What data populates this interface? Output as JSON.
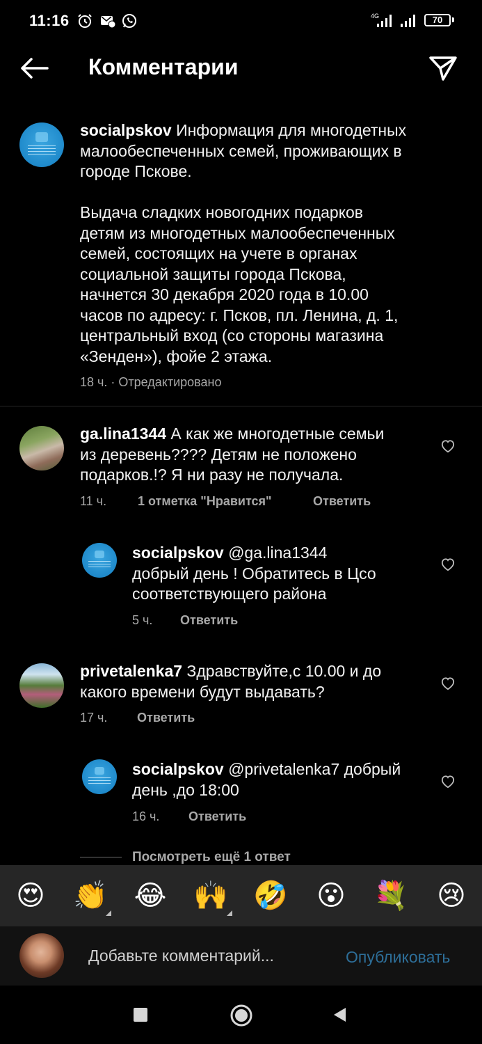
{
  "status_bar": {
    "time": "11:16",
    "network_label": "4G",
    "battery": "70"
  },
  "header": {
    "title": "Комментарии"
  },
  "post": {
    "username": "socialpskov",
    "caption_lines": [
      "Информация для многодетных",
      "малообеспеченных семей, проживающих в",
      "городе Пскове.",
      "",
      "Выдача сладких новогодних подарков",
      "детям из многодетных малообеспеченных",
      "семей, состоящих на учете в органах",
      "социальной защиты города Пскова,",
      "начнется 30 декабря 2020 года в 10.00",
      "часов по адресу: г. Псков, пл. Ленина, д. 1,",
      "центральный вход (со стороны магазина",
      "«Зенден»), фойе 2 этажа."
    ],
    "meta": "18 ч. · Отредактировано"
  },
  "comments": [
    {
      "username": "ga.lina1344",
      "first_line": "А как же многодетные  семьи",
      "lines": [
        "из деревень???? Детям не положено",
        "подарков.!? Я ни разу не получала."
      ],
      "time": "11 ч.",
      "likes": "1 отметка \"Нравится\"",
      "reply": "Ответить"
    },
    {
      "username": "socialpskov",
      "first_line": "@ga.lina1344",
      "lines": [
        "добрый день ! Обратитесь в Цсо",
        "соответствующего района"
      ],
      "time": "5 ч.",
      "reply": "Ответить"
    },
    {
      "username": "privetalenka7",
      "first_line": "Здравствуйте,с 10.00 и до",
      "lines": [
        "какого времени будут выдавать?"
      ],
      "time": "17 ч.",
      "reply": "Ответить"
    },
    {
      "username": "socialpskov",
      "first_line": "@privetalenka7 добрый",
      "lines": [
        "день ,до 18:00"
      ],
      "time": "16 ч.",
      "reply": "Ответить"
    }
  ],
  "view_more": "Посмотреть ещё 1 ответ",
  "emojis": [
    "😍",
    "👏",
    "😂",
    "🙌",
    "🤣",
    "😮",
    "💐",
    "😢"
  ],
  "composer": {
    "placeholder": "Добавьте комментарий...",
    "publish": "Опубликовать"
  },
  "colors": {
    "background": "#000000",
    "secondary_text": "#a8a8a8",
    "publish_disabled": "#2d6e98",
    "emoji_bar": "#262626"
  }
}
